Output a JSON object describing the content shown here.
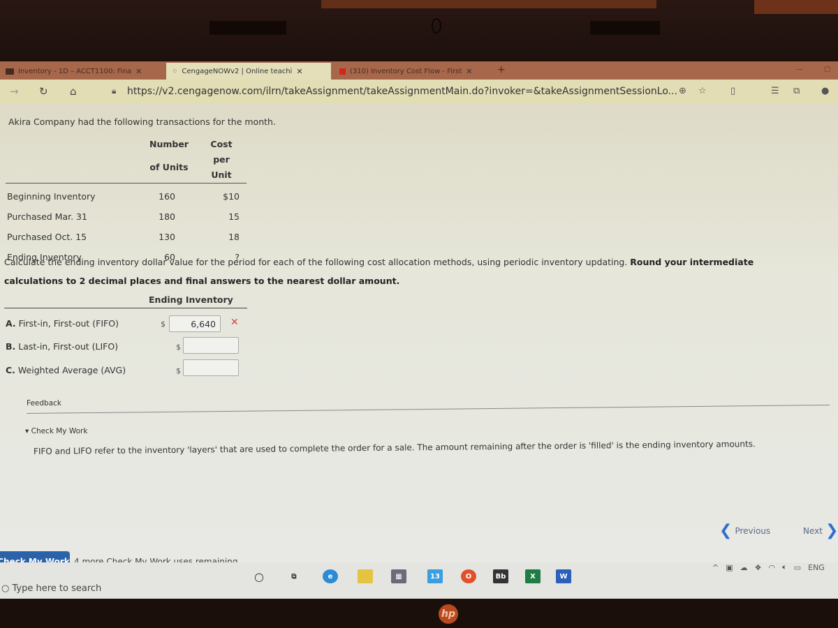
{
  "browser": {
    "tabs": [
      {
        "label": "Inventory - 1D – ACCT1100: Fina",
        "icon": "blackboard-icon",
        "active": false
      },
      {
        "label": "CengageNOWv2 | Online teachi",
        "icon": "loading-spinner-icon",
        "active": true
      },
      {
        "label": "(310) Inventory Cost Flow - First",
        "icon": "youtube-icon",
        "active": false
      }
    ],
    "close_glyph": "✕",
    "new_tab_glyph": "+",
    "url": "https://v2.cengagenow.com/ilrn/takeAssignment/takeAssignmentMain.do?invoker=&takeAssignmentSessionLo..."
  },
  "problem": {
    "intro": "Akira Company had the following transactions for the month.",
    "table": {
      "headers": {
        "units_line1": "Number",
        "units_line2": "of Units",
        "cost_line1": "Cost",
        "cost_line2": "per Unit"
      },
      "rows": [
        {
          "label": "Beginning Inventory",
          "units": "160",
          "cost": "$10"
        },
        {
          "label": "Purchased Mar. 31",
          "units": "180",
          "cost": "15"
        },
        {
          "label": "Purchased Oct. 15",
          "units": "130",
          "cost": "18"
        },
        {
          "label": "Ending Inventory",
          "units": "60",
          "cost": "?"
        }
      ]
    },
    "instruction_plain": "Calculate the ending inventory dollar value for the period for each of the following cost allocation methods, using periodic inventory updating.",
    "instruction_bold": "Round your intermediate calculations to 2 decimal places and final answers to the nearest dollar amount."
  },
  "answers": {
    "heading": "Ending Inventory",
    "currency": "$",
    "rows": [
      {
        "letter": "A.",
        "method": "First-in, First-out (FIFO)",
        "value": "6,640",
        "status": "incorrect",
        "status_glyph": "✕"
      },
      {
        "letter": "B.",
        "method": "Last-in, First-out (LIFO)",
        "value": "",
        "status": ""
      },
      {
        "letter": "C.",
        "method": "Weighted Average (AVG)",
        "value": "",
        "status": ""
      }
    ]
  },
  "feedback": {
    "label": "Feedback",
    "toggle": "▾ Check My Work",
    "text": "FIFO and LIFO refer to the inventory 'layers' that are used to complete the order for a sale. The amount remaining after the order is 'filled' is the ending inventory amounts."
  },
  "navigation": {
    "previous": "Previous",
    "next": "Next"
  },
  "footer": {
    "check_button": "Check My Work",
    "remaining": "4 more Check My Work uses remaining."
  },
  "taskbar": {
    "search_placeholder": "Type here to search",
    "mail_badge": "13",
    "tray_language": "ENG"
  },
  "colors": {
    "accent_blue": "#2a63a9",
    "error_red": "#e0413a"
  }
}
